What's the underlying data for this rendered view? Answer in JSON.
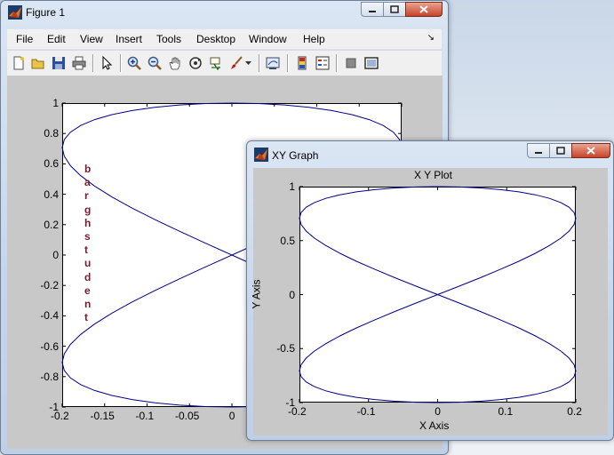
{
  "figure1": {
    "title": "Figure 1",
    "menu": [
      "File",
      "Edit",
      "View",
      "Insert",
      "Tools",
      "Desktop",
      "Window",
      "Help"
    ],
    "dock_glyph": "↘",
    "yticks": [
      "1",
      "0.8",
      "0.6",
      "0.4",
      "0.2",
      "0",
      "-0.2",
      "-0.4",
      "-0.6",
      "-0.8",
      "-1"
    ],
    "xticks": [
      "-0.2",
      "-0.15",
      "-0.1",
      "-0.05",
      "0"
    ],
    "vertical_text": [
      "b",
      "a",
      "r",
      "g",
      "h",
      "s",
      "t",
      "u",
      "d",
      "e",
      "n",
      "t"
    ]
  },
  "xygraph": {
    "title": "XY Graph",
    "plot_title": "X Y Plot",
    "xlabel": "X Axis",
    "ylabel": "Y Axis",
    "yticks": [
      "1",
      "0.5",
      "0",
      "-0.5",
      "-1"
    ],
    "xticks": [
      "-0.2",
      "-0.1",
      "0",
      "0.1",
      "0.2"
    ]
  },
  "colors": {
    "curve": "#00008b",
    "vertical_text": "#7b1b2f",
    "plot_bg": "#c8c8c8"
  },
  "chart_data": [
    {
      "type": "line",
      "title": "",
      "xlabel": "",
      "ylabel": "",
      "xlim": [
        -0.2,
        0.2
      ],
      "ylim": [
        -1,
        1
      ],
      "series": [
        {
          "x_expr": "0.2*sin(2t)",
          "y_expr": "cos(t)"
        }
      ]
    },
    {
      "type": "line",
      "title": "X Y Plot",
      "xlabel": "X Axis",
      "ylabel": "Y Axis",
      "xlim": [
        -0.2,
        0.2
      ],
      "ylim": [
        -1,
        1
      ],
      "series": [
        {
          "x_expr": "0.2*sin(2t)",
          "y_expr": "cos(t)"
        }
      ]
    }
  ]
}
